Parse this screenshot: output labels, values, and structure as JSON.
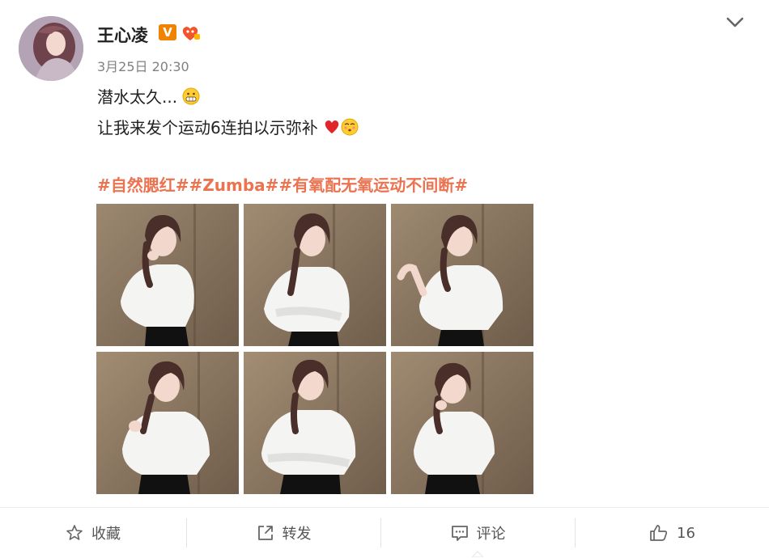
{
  "user": {
    "name": "王心凌",
    "verified_badge": "V",
    "fan_badge_icon": "fan-badge-icon",
    "avatar_icon": "avatar"
  },
  "post": {
    "time": "3月25日 20:30",
    "line1": "潜水太久...",
    "line2": "让我来发个运动6连拍以示弥补",
    "hashtags": [
      "#自然腮红#",
      "#Zumba#",
      "#有氧配无氧运动不间断#"
    ],
    "photo_count": 6
  },
  "actions": {
    "favorite": {
      "label": "收藏",
      "icon": "star-icon"
    },
    "repost": {
      "label": "转发",
      "icon": "share-icon"
    },
    "comment": {
      "label": "评论",
      "icon": "comment-icon"
    },
    "like": {
      "label": "16",
      "icon": "thumbs-up-icon"
    }
  },
  "colors": {
    "hashtag": "#eb7350",
    "badge_v": "#f08300",
    "text_muted": "#808080"
  }
}
